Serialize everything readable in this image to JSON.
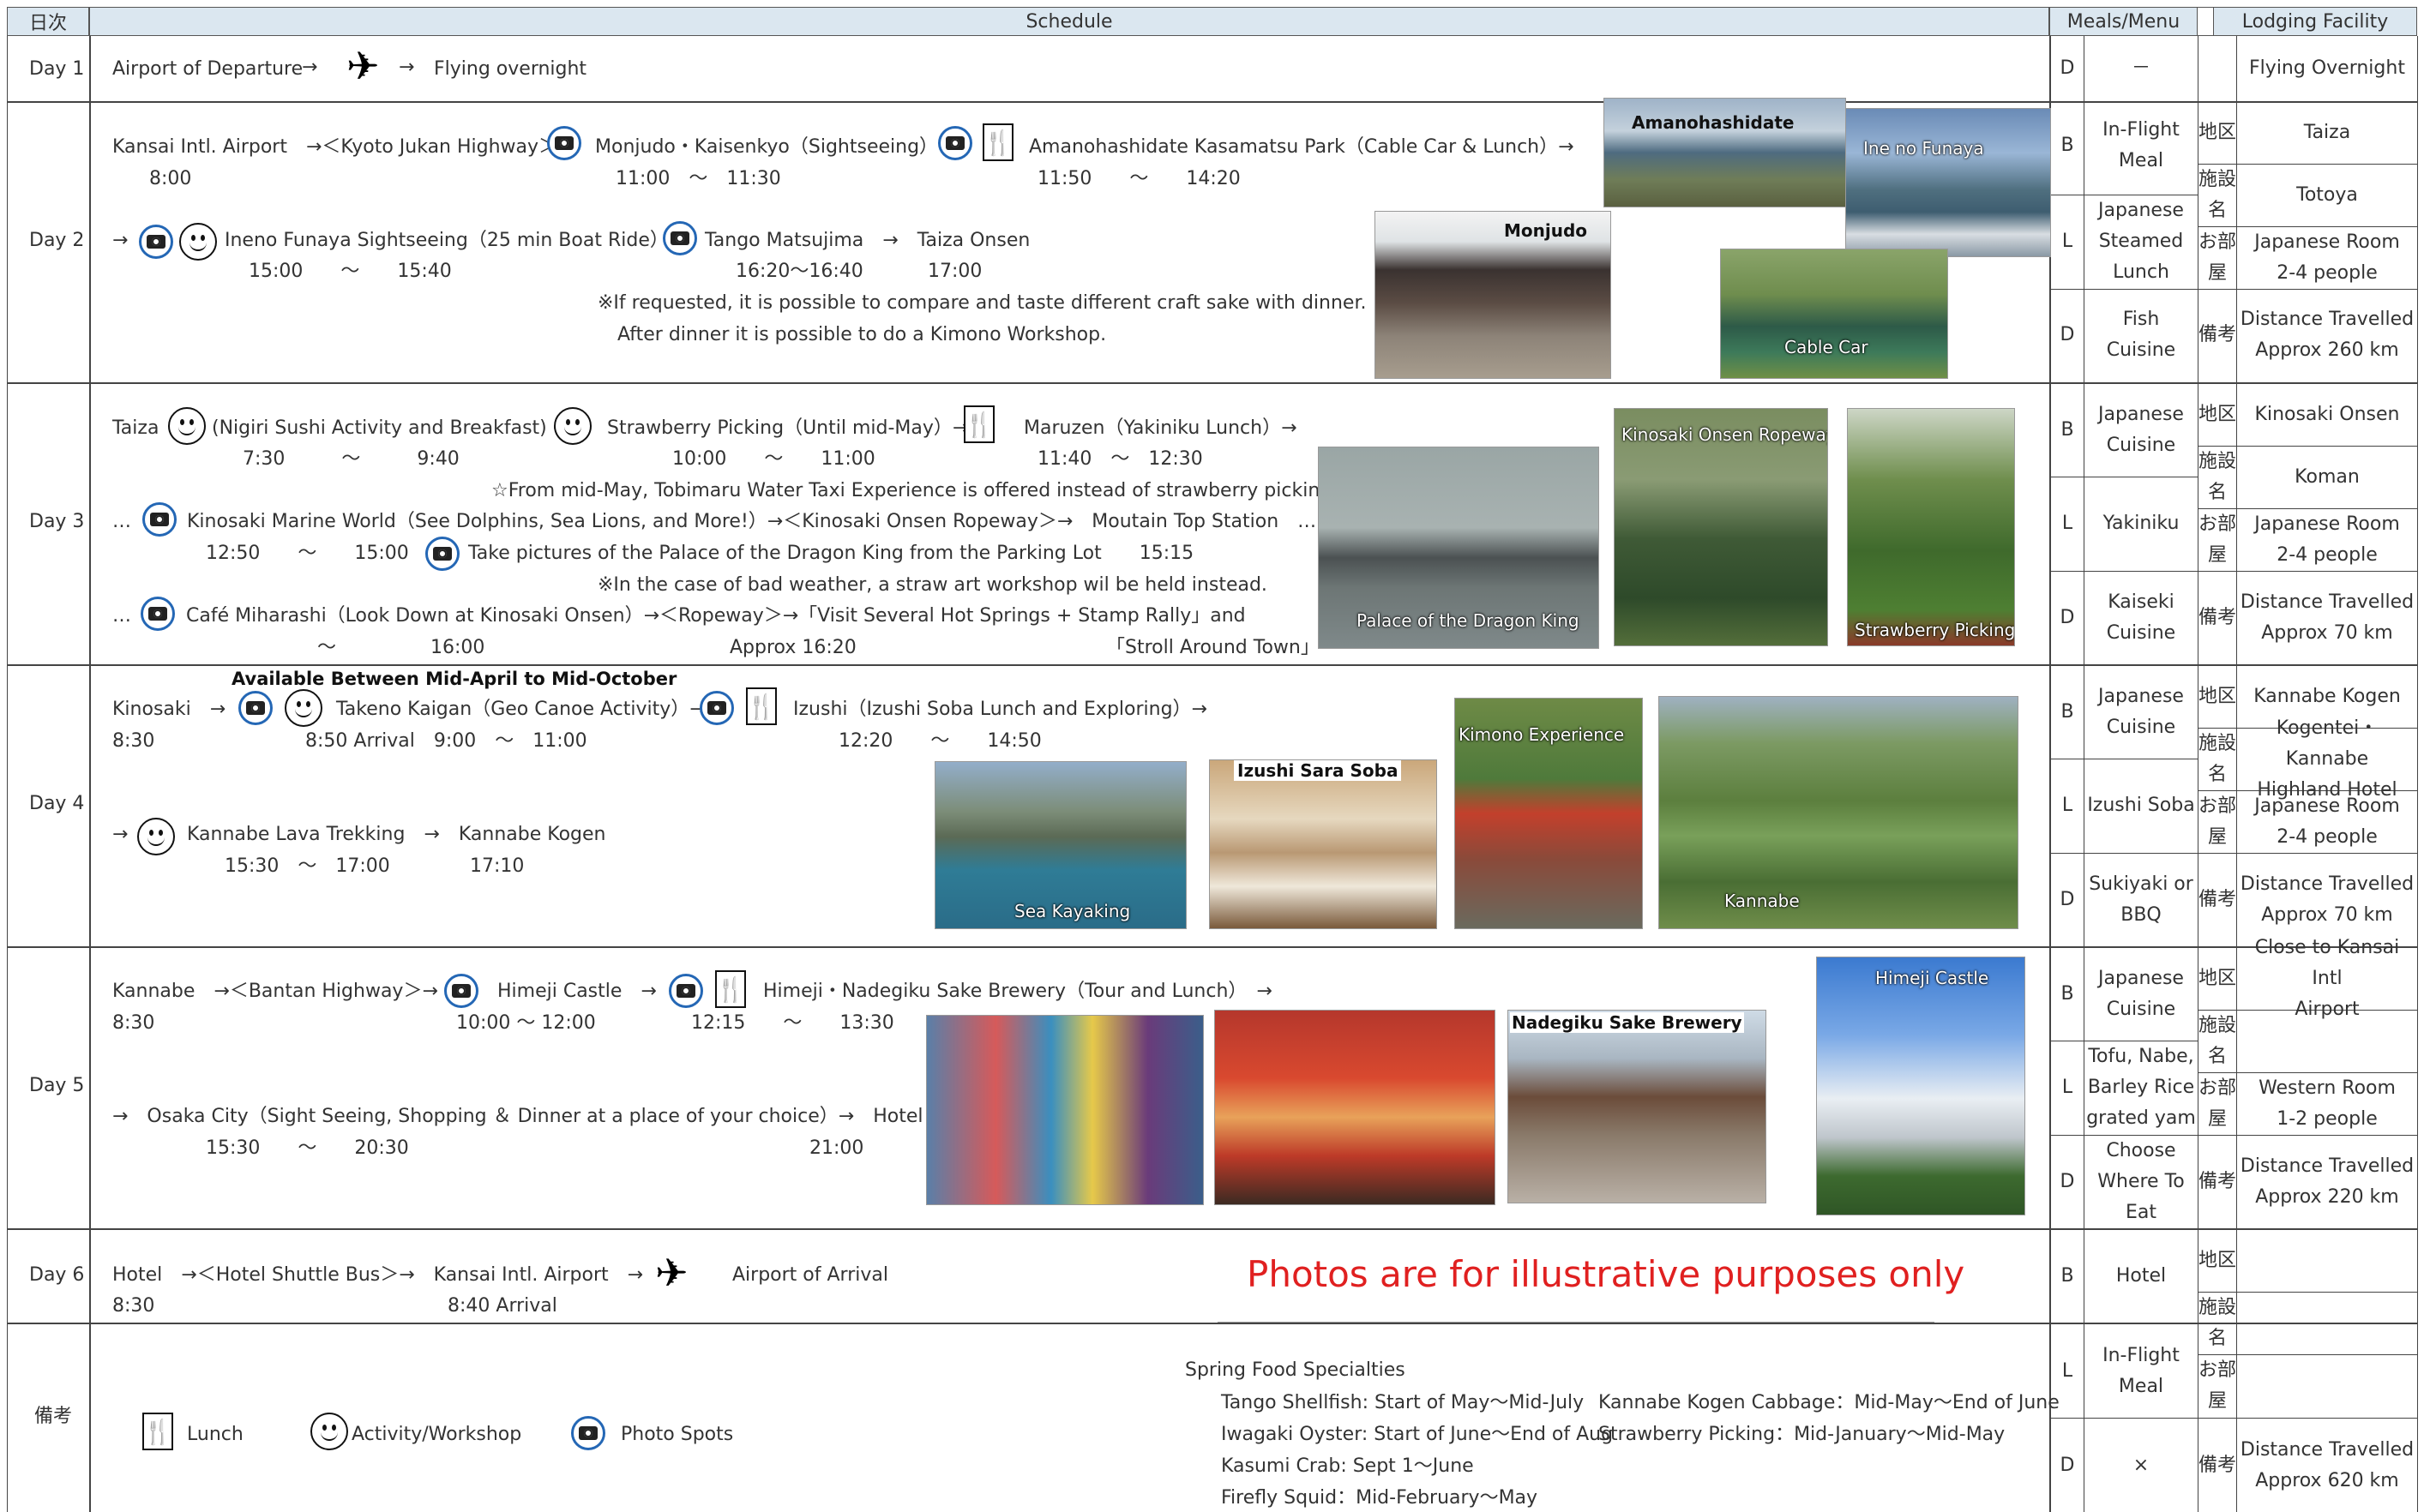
{
  "header": {
    "day_col": "日次",
    "schedule": "Schedule",
    "meals": "Meals/Menu",
    "lodging": "Lodging Facility"
  },
  "day1": {
    "label": "Day 1",
    "line1": {
      "depart": "Airport of Departure",
      "arrow": "→",
      "arrow2": "→",
      "flying": "Flying overnight"
    },
    "meal_code": "D",
    "meal": "－",
    "lodging": "Flying Overnight"
  },
  "day2": {
    "label": "Day 2",
    "l1a": "Kansai Intl. Airport　→＜Kyoto Jukan Highway＞→",
    "l1b": "Monjudo・Kaisenkyo（Sightseeing）→",
    "l1c": "Amanohashidate Kasamatsu Park（Cable Car & Lunch）→",
    "t1a": "8:00",
    "t1b": "11:00　～　11:30",
    "t1c": "11:50　　～　　14:20",
    "l2a": "→",
    "l2b": "Ineno Funaya Sightseeing（25 min Boat Ride）→",
    "l2c": "Tango Matsujima　→　Taiza Onsen",
    "t2a": "15:00　　～　　15:40",
    "t2b": "16:20～16:40",
    "t2c": "17:00",
    "note1": "※If requested, it is possible to compare and taste different craft sake with dinner.",
    "note2": "After dinner it is possible to do a Kimono Workshop.",
    "photos": {
      "amano": "Amanohashidate",
      "ineno": "Ine no Funaya",
      "monjudo": "Monjudo",
      "cable": "Cable Car"
    },
    "meals": [
      {
        "code": "B",
        "text": "In-Flight\nMeal"
      },
      {
        "code": "L",
        "text": "Japanese\nSteamed\nLunch"
      },
      {
        "code": "D",
        "text": "Fish\nCuisine"
      }
    ],
    "lodging": {
      "area": "Taiza",
      "facility": "Totoya",
      "room": "Japanese Room\n2-4 people",
      "note": "Distance Travelled\nApprox 260 km"
    }
  },
  "day3": {
    "label": "Day 3",
    "l1a": "Taiza",
    "l1b": "(Nigiri Sushi Activity and Breakfast) →",
    "l1c": "Strawberry Picking（Until mid-May）→",
    "l1d": "Maruzen（Yakiniku Lunch）→",
    "t1a": "7:30　　　～　　　9:40",
    "t1b": "10:00　　～　　11:00",
    "t1c": "11:40　～　12:30",
    "note1": "☆From mid-May, Tobimaru Water Taxi Experience is offered instead of strawberry picking",
    "l2a": "…",
    "l2b": "Kinosaki Marine World（See Dolphins, Sea Lions, and More!）→＜Kinosaki Onsen Ropeway＞→　Moutain Top Station　…",
    "t2a": "12:50　　～　　15:00",
    "t2b": "Take pictures of the Palace of the Dragon King from the Parking Lot　　15:15　　　　　　　～",
    "note2": "※In the case of bad weather, a straw art workshop wil be held instead.",
    "l3a": "…",
    "l3b": "Café Miharashi（Look Down at Kinosaki Onsen）→＜Ropeway＞→「Visit Several Hot Springs + Stamp Rally」and",
    "t3a": "～　　　　　16:00",
    "t3b": "Approx 16:20",
    "t3c": "「Stroll Around Town」",
    "photos": {
      "palace": "Palace of the Dragon King",
      "ropeway": "Kinosaki Onsen Ropeway",
      "strawberry": "Strawberry Picking"
    },
    "meals": [
      {
        "code": "B",
        "text": "Japanese\nCuisine"
      },
      {
        "code": "L",
        "text": "Yakiniku"
      },
      {
        "code": "D",
        "text": "Kaiseki\nCuisine"
      }
    ],
    "lodging": {
      "area": "Kinosaki Onsen",
      "facility": "Koman",
      "room": "Japanese Room\n2-4 people",
      "note": "Distance Travelled\nApprox 70 km"
    }
  },
  "day4": {
    "label": "Day 4",
    "avail": "Available Between Mid-April to Mid-October",
    "l1a": "Kinosaki　→",
    "l1b": "Takeno Kaigan（Geo Canoe Activity）→",
    "l1c": "Izushi（Izushi Soba Lunch and Exploring）→",
    "t1a": "8:30",
    "t1b": "8:50 Arrival　9:00　～　11:00",
    "t1c": "12:20　　～　　14:50",
    "l2a": "→",
    "l2b": "Kannabe Lava Trekking　→　Kannabe Kogen",
    "t2a": "15:30　～　17:00",
    "t2b": "17:10",
    "photos": {
      "kayak": "Sea Kayaking",
      "soba": "Izushi Sara Soba",
      "kimono": "Kimono Experience",
      "kannabe": "Kannabe"
    },
    "meals": [
      {
        "code": "B",
        "text": "Japanese\nCuisine"
      },
      {
        "code": "L",
        "text": "Izushi Soba"
      },
      {
        "code": "D",
        "text": "Sukiyaki or\nBBQ"
      }
    ],
    "lodging": {
      "area": "Kannabe Kogen",
      "facility": "Kogentei・Kannabe\nHighland Hotel",
      "room": "Japanese Room\n2-4 people",
      "note": "Distance Travelled\nApprox 70 km"
    }
  },
  "day5": {
    "label": "Day 5",
    "l1a": "Kannabe　→＜Bantan Highway＞→",
    "l1b": "Himeji Castle　→",
    "l1c": "Himeji・Nadegiku Sake Brewery（Tour and Lunch）　→",
    "t1a": "8:30",
    "t1b": "10:00 ～ 12:00",
    "t1c": "12:15　　～　　13:30",
    "l2a": "→　Osaka City（Sight Seeing, Shopping ＆ Dinner at a place of your choice）→　Hotel",
    "t2a": "15:30　　～　　20:30",
    "t2b": "21:00",
    "photos": {
      "nadegiku": "Nadegiku Sake Brewery",
      "himeji": "Himeji Castle"
    },
    "meals": [
      {
        "code": "B",
        "text": "Japanese\nCuisine"
      },
      {
        "code": "L",
        "text": "Tofu, Nabe,\nBarley Rice\ngrated yam"
      },
      {
        "code": "D",
        "text": "Choose\nWhere To\nEat"
      }
    ],
    "lodging": {
      "area": "Close to Kansai Intl\nAirport",
      "facility": "",
      "room": "Western Room\n1-2 people",
      "note": "Distance Travelled\nApprox 220 km"
    }
  },
  "day6": {
    "label": "Day 6",
    "l1a": "Hotel　→＜Hotel Shuttle Bus＞→　Kansai Intl. Airport　→",
    "l1b": "Airport of Arrival",
    "t1a": "8:30",
    "t1b": "8:40 Arrival",
    "disclaimer": "Photos are for illustrative purposes only",
    "meal_code": "B",
    "meal": "Hotel"
  },
  "notes": {
    "label": "備考",
    "legend": {
      "lunch": "Lunch",
      "activity": "Activity/Workshop",
      "photo": "Photo Spots"
    },
    "spring_title": "Spring Food Specialties",
    "spring": [
      "Tango Shellfish: Start of May～Mid-July",
      "Iwagaki Oyster: Start of June～End of Aug",
      "Kasumi Crab: Sept 1～June",
      "Firefly Squid：Mid-February～May"
    ],
    "spring2": [
      "Kannabe Kogen Cabbage：Mid-May～End of June",
      "Strawberry Picking：Mid-January～Mid-May"
    ],
    "meals": [
      {
        "code": "L",
        "text": "In-Flight\nMeal"
      },
      {
        "code": "D",
        "text": "×"
      }
    ],
    "lodging_note": "Distance Travelled\nApprox 620 km"
  },
  "lodging_labels": {
    "area": "地区",
    "facility": "施設名",
    "room": "お部屋",
    "note": "備考"
  },
  "colors": {
    "header_bg": "#dbe7f0",
    "camera_ring": "#2467b5",
    "disclaimer": "#e02020"
  }
}
